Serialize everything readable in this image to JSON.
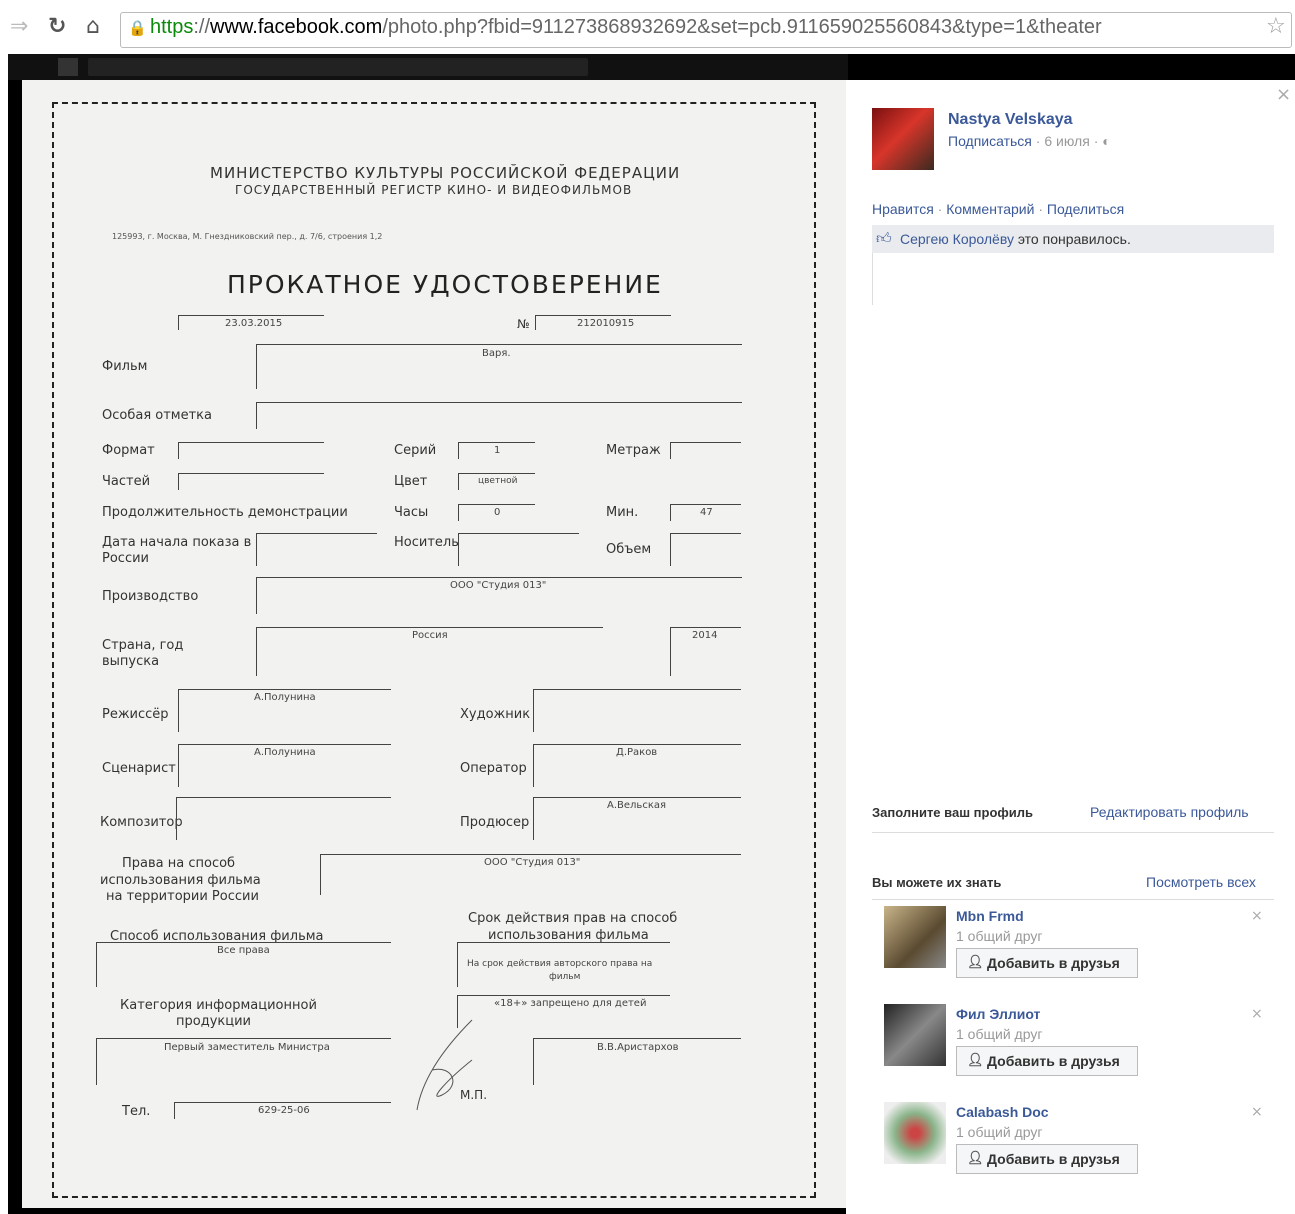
{
  "browser": {
    "url_scheme": "https",
    "url_sep": "://",
    "url_host": "www.facebook.com",
    "url_path": "/photo.php?fbid=911273868932692&set=pcb.911659025560843&type=1&theater",
    "back_icon": "forward-arrow-icon",
    "reload_icon": "reload-icon",
    "home_icon": "home-icon",
    "star_icon": "star-icon"
  },
  "document": {
    "ministry": "МИНИСТЕРСТВО КУЛЬТУРЫ РОССИЙСКОЙ ФЕДЕРАЦИИ",
    "registry": "ГОСУДАРСТВЕННЫЙ РЕГИСТР КИНО- И ВИДЕОФИЛЬМОВ",
    "address": "125993, г. Москва, М. Гнездниковский пер., д. 7/6, строения 1,2",
    "title": "ПРОКАТНОЕ УДОСТОВЕРЕНИЕ",
    "date": "23.03.2015",
    "number_label": "№",
    "number": "212010915",
    "labels": {
      "film": "Фильм",
      "special": "Особая отметка",
      "format": "Формат",
      "series": "Серий",
      "footage": "Метраж",
      "parts": "Частей",
      "color": "Цвет",
      "duration": "Продолжительность демонстрации",
      "hours": "Часы",
      "minutes": "Мин.",
      "start_date_1": "Дата начала показа в",
      "start_date_2": "России",
      "carrier": "Носитель",
      "volume": "Объем",
      "production": "Производство",
      "country_1": "Страна, год",
      "country_2": "выпуска",
      "director": "Режиссёр",
      "artist": "Художник",
      "writer": "Сценарист",
      "operator": "Оператор",
      "composer": "Композитор",
      "producer": "Продюсер",
      "rights_1": "Права на способ",
      "rights_2": "использования фильма",
      "rights_3": "на территории России",
      "term_1": "Срок действия прав на способ",
      "term_2": "использования фильма",
      "usage": "Способ использования фильма",
      "category_1": "Категория информационной",
      "category_2": "продукции",
      "stamp": "М.П.",
      "phone": "Тел."
    },
    "values": {
      "film": "Варя.",
      "series": "1",
      "color": "цветной",
      "hours": "0",
      "minutes": "47",
      "production": "ООО \"Студия 013\"",
      "country": "Россия",
      "year": "2014",
      "director": "А.Полунина",
      "writer": "А.Полунина",
      "operator": "Д.Раков",
      "producer": "А.Вельская",
      "rights": "ООО \"Студия 013\"",
      "usage": "Все права",
      "term_1": "На срок действия авторского права на",
      "term_2": "фильм",
      "category": "«18+» запрещено для детей",
      "signer_position": "Первый заместитель Министра",
      "signer_name": "В.В.Аристархов",
      "phone": "629-25-06"
    }
  },
  "panel": {
    "author": "Nastya Velskaya",
    "subscribe": "Подписаться",
    "date": "6 июля",
    "sep": "·",
    "actions": {
      "like": "Нравится",
      "comment": "Комментарий",
      "share": "Поделиться"
    },
    "liked_by": "Сергею Королёву",
    "liked_text": "это понравилось.",
    "fill_profile": "Заполните ваш профиль",
    "edit_profile": "Редактировать профиль",
    "pymk_title": "Вы можете их знать",
    "see_all": "Посмотреть всех",
    "people": [
      {
        "name": "Mbn Frmd",
        "mutual": "1 общий друг",
        "button": "Добавить в друзья"
      },
      {
        "name": "Фил Эллиот",
        "mutual": "1 общий друг",
        "button": "Добавить в друзья"
      },
      {
        "name": "Calabash Doc",
        "mutual": "1 общий друг",
        "button": "Добавить в друзья"
      }
    ],
    "close_glyph": "×"
  }
}
